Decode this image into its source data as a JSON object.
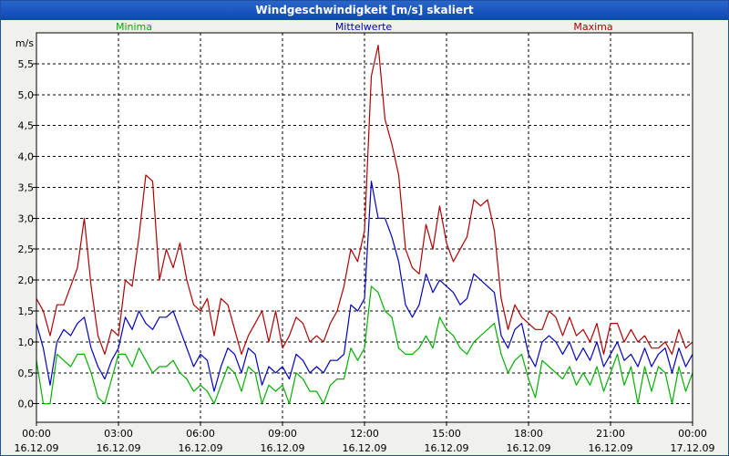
{
  "window": {
    "title": "Windgeschwindigkeit [m/s] skaliert"
  },
  "chart_data": {
    "type": "line",
    "title": "Windgeschwindigkeit [m/s] skaliert",
    "ylabel": "m/s",
    "ylim": [
      -0.3,
      6.0
    ],
    "y_ticks": [
      "0,0",
      "0,5",
      "1,0",
      "1,5",
      "2,0",
      "2,5",
      "3,0",
      "3,5",
      "4,0",
      "4,5",
      "5,0",
      "5,5"
    ],
    "y_tick_values": [
      0,
      0.5,
      1.0,
      1.5,
      2.0,
      2.5,
      3.0,
      3.5,
      4.0,
      4.5,
      5.0,
      5.5
    ],
    "x_range_hours": [
      0,
      24
    ],
    "x_ticks": [
      {
        "time": "00:00",
        "date": "16.12.09"
      },
      {
        "time": "03:00",
        "date": "16.12.09"
      },
      {
        "time": "06:00",
        "date": "16.12.09"
      },
      {
        "time": "09:00",
        "date": "16.12.09"
      },
      {
        "time": "12:00",
        "date": "16.12.09"
      },
      {
        "time": "15:00",
        "date": "16.12.09"
      },
      {
        "time": "18:00",
        "date": "16.12.09"
      },
      {
        "time": "21:00",
        "date": "16.12.09"
      },
      {
        "time": "00:00",
        "date": "17.12.09"
      }
    ],
    "grid": true,
    "legend_position": "top",
    "series": [
      {
        "name": "Minima",
        "color": "#00b000",
        "x": [
          0.0,
          0.25,
          0.5,
          0.75,
          1.0,
          1.25,
          1.5,
          1.75,
          2.0,
          2.25,
          2.5,
          2.75,
          3.0,
          3.25,
          3.5,
          3.75,
          4.0,
          4.25,
          4.5,
          4.75,
          5.0,
          5.25,
          5.5,
          5.75,
          6.0,
          6.25,
          6.5,
          6.75,
          7.0,
          7.25,
          7.5,
          7.75,
          8.0,
          8.25,
          8.5,
          8.75,
          9.0,
          9.25,
          9.5,
          9.75,
          10.0,
          10.25,
          10.5,
          10.75,
          11.0,
          11.25,
          11.5,
          11.75,
          12.0,
          12.25,
          12.5,
          12.75,
          13.0,
          13.25,
          13.5,
          13.75,
          14.0,
          14.25,
          14.5,
          14.75,
          15.0,
          15.25,
          15.5,
          15.75,
          16.0,
          16.25,
          16.5,
          16.75,
          17.0,
          17.25,
          17.5,
          17.75,
          18.0,
          18.25,
          18.5,
          18.75,
          19.0,
          19.25,
          19.5,
          19.75,
          20.0,
          20.25,
          20.5,
          20.75,
          21.0,
          21.25,
          21.5,
          21.75,
          22.0,
          22.25,
          22.5,
          22.75,
          23.0,
          23.25,
          23.5,
          23.75,
          24.0
        ],
        "values": [
          0.7,
          0.0,
          0.0,
          0.8,
          0.7,
          0.6,
          0.8,
          0.8,
          0.5,
          0.1,
          0.0,
          0.4,
          0.8,
          0.8,
          0.6,
          0.9,
          0.7,
          0.5,
          0.6,
          0.6,
          0.7,
          0.5,
          0.4,
          0.2,
          0.3,
          0.2,
          0.0,
          0.3,
          0.6,
          0.5,
          0.2,
          0.6,
          0.5,
          0.0,
          0.3,
          0.2,
          0.3,
          0.0,
          0.5,
          0.4,
          0.2,
          0.2,
          0.0,
          0.3,
          0.4,
          0.4,
          0.9,
          0.7,
          0.9,
          1.9,
          1.8,
          1.5,
          1.4,
          0.9,
          0.8,
          0.8,
          0.9,
          1.1,
          0.9,
          1.4,
          1.2,
          1.1,
          0.9,
          0.8,
          1.0,
          1.1,
          1.2,
          1.3,
          0.8,
          0.5,
          0.7,
          0.8,
          0.4,
          0.1,
          0.7,
          0.6,
          0.5,
          0.4,
          0.6,
          0.3,
          0.5,
          0.3,
          0.6,
          0.2,
          0.5,
          0.8,
          0.3,
          0.6,
          0.0,
          0.6,
          0.2,
          0.6,
          0.5,
          0.0,
          0.6,
          0.2,
          0.5
        ]
      },
      {
        "name": "Mittelwerte",
        "color": "#0000c0",
        "x": [
          0.0,
          0.25,
          0.5,
          0.75,
          1.0,
          1.25,
          1.5,
          1.75,
          2.0,
          2.25,
          2.5,
          2.75,
          3.0,
          3.25,
          3.5,
          3.75,
          4.0,
          4.25,
          4.5,
          4.75,
          5.0,
          5.25,
          5.5,
          5.75,
          6.0,
          6.25,
          6.5,
          6.75,
          7.0,
          7.25,
          7.5,
          7.75,
          8.0,
          8.25,
          8.5,
          8.75,
          9.0,
          9.25,
          9.5,
          9.75,
          10.0,
          10.25,
          10.5,
          10.75,
          11.0,
          11.25,
          11.5,
          11.75,
          12.0,
          12.25,
          12.5,
          12.75,
          13.0,
          13.25,
          13.5,
          13.75,
          14.0,
          14.25,
          14.5,
          14.75,
          15.0,
          15.25,
          15.5,
          15.75,
          16.0,
          16.25,
          16.5,
          16.75,
          17.0,
          17.25,
          17.5,
          17.75,
          18.0,
          18.25,
          18.5,
          18.75,
          19.0,
          19.25,
          19.5,
          19.75,
          20.0,
          20.25,
          20.5,
          20.75,
          21.0,
          21.25,
          21.5,
          21.75,
          22.0,
          22.25,
          22.5,
          22.75,
          23.0,
          23.25,
          23.5,
          23.75,
          24.0
        ],
        "values": [
          1.3,
          0.9,
          0.3,
          1.0,
          1.2,
          1.1,
          1.3,
          1.4,
          0.9,
          0.6,
          0.4,
          0.7,
          0.9,
          1.4,
          1.2,
          1.5,
          1.3,
          1.2,
          1.4,
          1.4,
          1.5,
          1.2,
          0.9,
          0.6,
          0.8,
          0.7,
          0.2,
          0.6,
          0.9,
          0.8,
          0.5,
          0.9,
          0.8,
          0.3,
          0.6,
          0.5,
          0.6,
          0.4,
          0.8,
          0.7,
          0.5,
          0.6,
          0.5,
          0.7,
          0.7,
          0.8,
          1.6,
          1.5,
          1.7,
          3.6,
          3.0,
          3.0,
          2.7,
          2.3,
          1.6,
          1.4,
          1.6,
          2.1,
          1.8,
          2.0,
          1.9,
          1.8,
          1.6,
          1.7,
          2.1,
          2.0,
          1.9,
          1.8,
          1.1,
          0.9,
          1.2,
          1.3,
          0.8,
          0.6,
          1.0,
          1.1,
          1.0,
          0.8,
          1.0,
          0.7,
          0.9,
          0.7,
          1.0,
          0.6,
          0.8,
          1.0,
          0.7,
          0.8,
          0.6,
          0.9,
          0.6,
          0.8,
          0.9,
          0.5,
          0.9,
          0.6,
          0.8
        ]
      },
      {
        "name": "Maxima",
        "color": "#b00000",
        "x": [
          0.0,
          0.25,
          0.5,
          0.75,
          1.0,
          1.25,
          1.5,
          1.75,
          2.0,
          2.25,
          2.5,
          2.75,
          3.0,
          3.25,
          3.5,
          3.75,
          4.0,
          4.25,
          4.5,
          4.75,
          5.0,
          5.25,
          5.5,
          5.75,
          6.0,
          6.25,
          6.5,
          6.75,
          7.0,
          7.25,
          7.5,
          7.75,
          8.0,
          8.25,
          8.5,
          8.75,
          9.0,
          9.25,
          9.5,
          9.75,
          10.0,
          10.25,
          10.5,
          10.75,
          11.0,
          11.25,
          11.5,
          11.75,
          12.0,
          12.25,
          12.5,
          12.75,
          13.0,
          13.25,
          13.5,
          13.75,
          14.0,
          14.25,
          14.5,
          14.75,
          15.0,
          15.25,
          15.5,
          15.75,
          16.0,
          16.25,
          16.5,
          16.75,
          17.0,
          17.25,
          17.5,
          17.75,
          18.0,
          18.25,
          18.5,
          18.75,
          19.0,
          19.25,
          19.5,
          19.75,
          20.0,
          20.25,
          20.5,
          20.75,
          21.0,
          21.25,
          21.5,
          21.75,
          22.0,
          22.25,
          22.5,
          22.75,
          23.0,
          23.25,
          23.5,
          23.75,
          24.0
        ],
        "values": [
          1.7,
          1.5,
          1.1,
          1.6,
          1.6,
          1.9,
          2.2,
          3.0,
          1.9,
          1.1,
          0.8,
          1.2,
          1.1,
          2.0,
          1.9,
          2.7,
          3.7,
          3.6,
          2.0,
          2.5,
          2.2,
          2.6,
          2.0,
          1.6,
          1.5,
          1.7,
          1.1,
          1.7,
          1.6,
          1.2,
          0.8,
          1.1,
          1.3,
          1.5,
          1.0,
          1.5,
          0.9,
          1.1,
          1.4,
          1.3,
          1.0,
          1.1,
          1.0,
          1.3,
          1.5,
          1.9,
          2.5,
          2.3,
          2.8,
          5.3,
          5.8,
          4.6,
          4.2,
          3.7,
          2.5,
          2.2,
          2.1,
          2.9,
          2.5,
          3.2,
          2.6,
          2.3,
          2.5,
          2.7,
          3.3,
          3.2,
          3.3,
          2.8,
          1.7,
          1.2,
          1.6,
          1.4,
          1.3,
          1.2,
          1.2,
          1.5,
          1.4,
          1.1,
          1.4,
          1.1,
          1.2,
          1.0,
          1.3,
          0.8,
          1.3,
          1.3,
          1.0,
          1.2,
          1.0,
          1.1,
          0.9,
          0.9,
          1.0,
          0.8,
          1.2,
          0.9,
          1.0
        ]
      }
    ]
  }
}
